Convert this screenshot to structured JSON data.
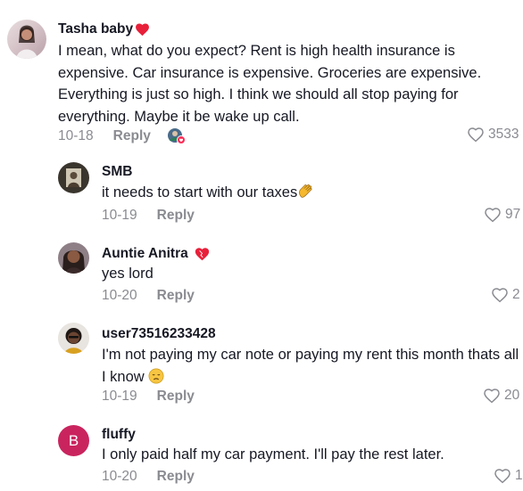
{
  "comments": [
    {
      "user": "Tasha baby",
      "text": "I mean, what do you expect? Rent is high health insurance is expensive. Car insurance is expensive. Groceries are expensive. Everything is just so high. I think we should all stop paying for everything. Maybe it be wake up call.",
      "date": "10-18",
      "reply_label": "Reply",
      "likes": "3533",
      "name_emoji": "heart-icon"
    },
    {
      "user": "SMB",
      "text": "it needs to start with our taxes",
      "text_emoji": "clapping-hands-icon",
      "date": "10-19",
      "reply_label": "Reply",
      "likes": "97"
    },
    {
      "user": "Auntie Anitra",
      "name_emoji": "heart-icon",
      "text": "yes lord",
      "date": "10-20",
      "reply_label": "Reply",
      "likes": "2"
    },
    {
      "user": "user73516233428",
      "text": "I'm not paying my car note or paying my rent this month thats all I know",
      "text_emoji": "disappointed-face-icon",
      "date": "10-19",
      "reply_label": "Reply",
      "likes": "20"
    },
    {
      "user": "fluffy",
      "avatar_letter": "B",
      "text": "I only paid half my car payment. I'll pay the rest later.",
      "date": "10-20",
      "reply_label": "Reply",
      "likes": "1"
    }
  ],
  "colors": {
    "heart": "#e8203a",
    "fluffy_avatar": "#c9245e",
    "meta": "#8a8b91",
    "text": "#161823"
  }
}
